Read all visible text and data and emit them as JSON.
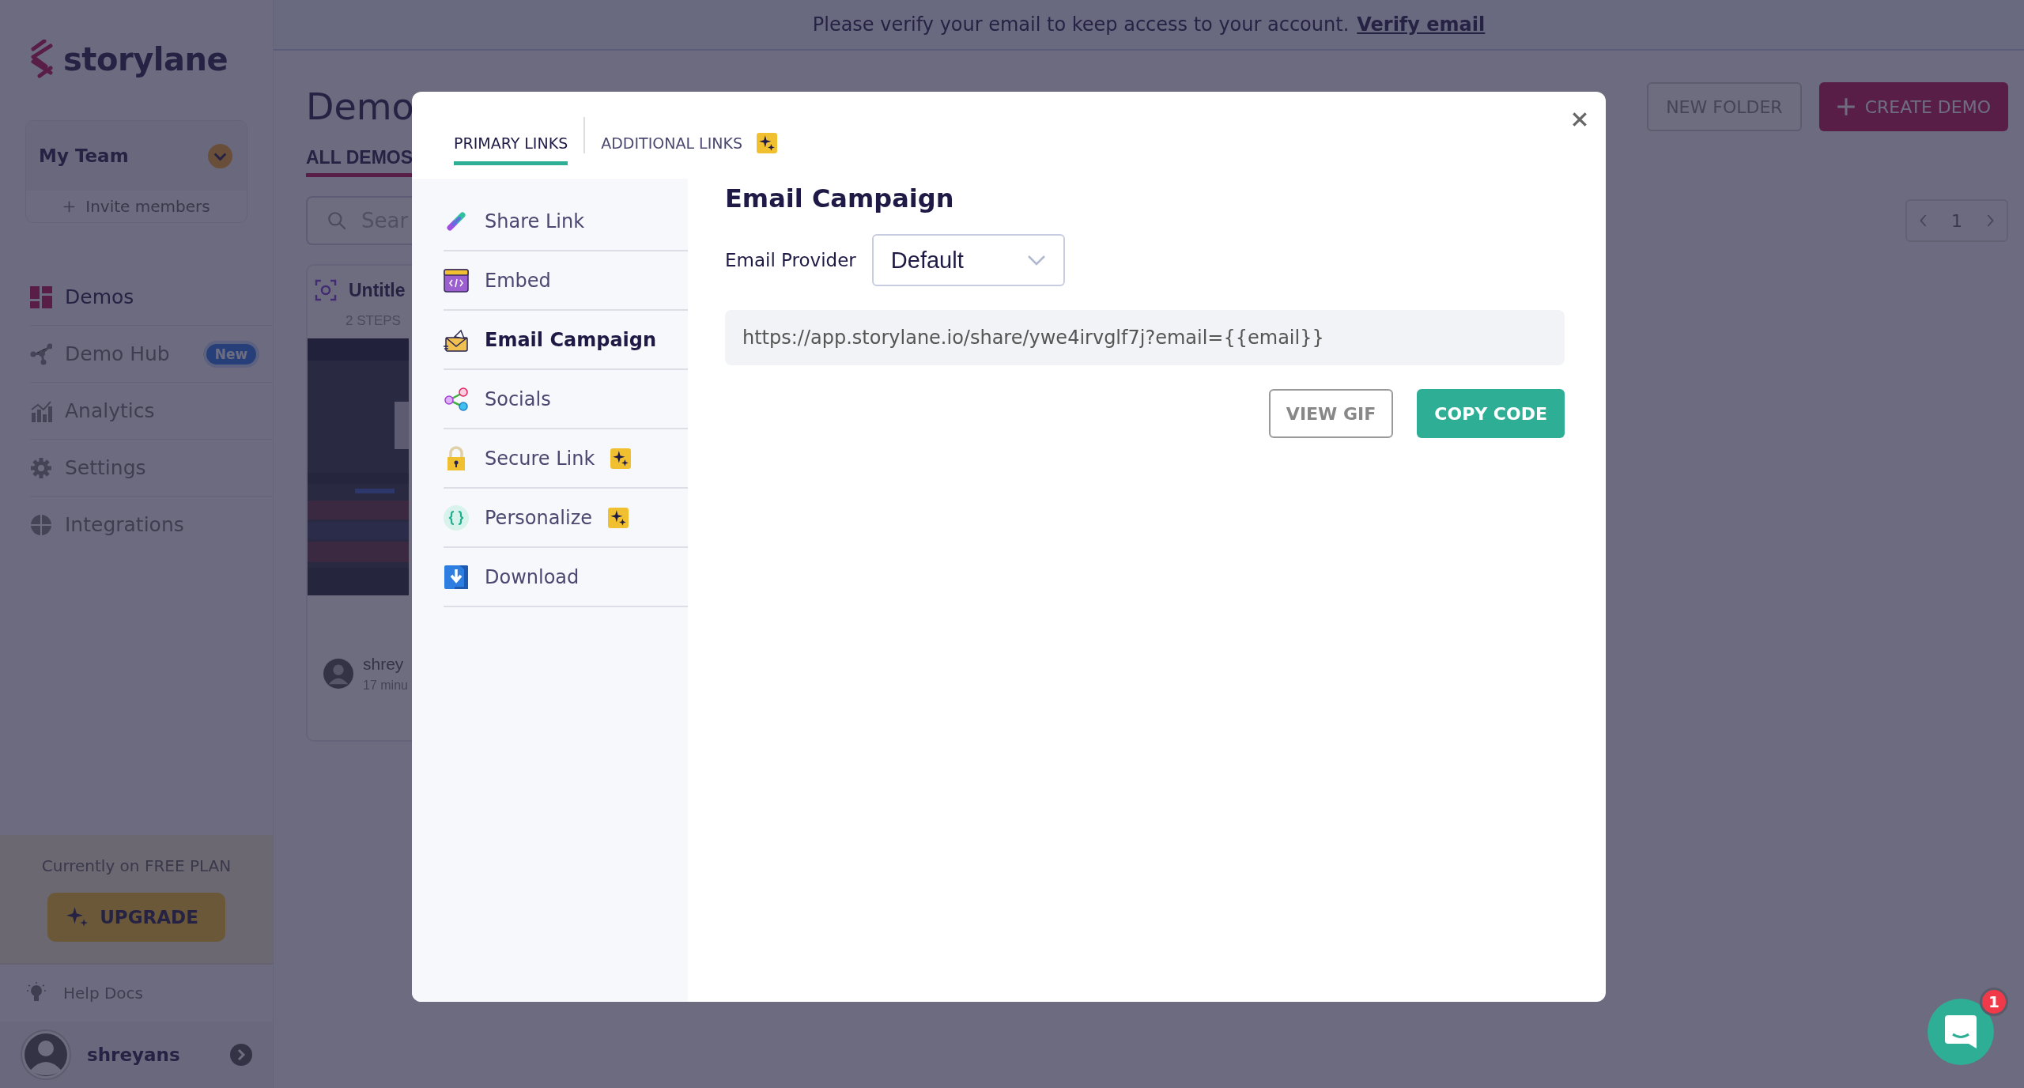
{
  "banner": {
    "text": "Please verify your email to keep access to your account.",
    "link": "Verify email"
  },
  "sidebar": {
    "logo": "storylane",
    "team": {
      "name": "My Team",
      "invite": "Invite members"
    },
    "nav": [
      {
        "label": "Demos",
        "kind": "demos",
        "selected": true
      },
      {
        "label": "Demo Hub",
        "kind": "hub",
        "badge": "New",
        "selected": false
      },
      {
        "label": "Analytics",
        "kind": "analytics",
        "selected": false
      },
      {
        "label": "Settings",
        "kind": "settings",
        "selected": false
      },
      {
        "label": "Integrations",
        "kind": "integrations",
        "selected": false
      }
    ],
    "plan": {
      "text": "Currently on FREE PLAN",
      "button": "UPGRADE"
    },
    "help": "Help Docs",
    "user": {
      "name": "shreyans"
    }
  },
  "main": {
    "title": "Demo",
    "tab": "ALL DEMOS",
    "search": {
      "placeholder": "Sear"
    },
    "buttons": [
      {
        "label": "NEW FOLDER",
        "kind": "outline"
      },
      {
        "label": "CREATE DEMO",
        "kind": "primary"
      }
    ],
    "pagination": {
      "page": "1"
    },
    "card": {
      "title": "Untitle",
      "steps": "2 STEPS",
      "author": "shrey",
      "time": "17 minu",
      "kind": "picture"
    }
  },
  "modal": {
    "tabs": [
      {
        "label": "PRIMARY LINKS",
        "selected": true,
        "premium": false
      },
      {
        "label": "ADDITIONAL LINKS",
        "selected": false,
        "premium": true
      }
    ],
    "nav": [
      {
        "label": "Share Link",
        "kind": "link",
        "selected": false,
        "premium": false
      },
      {
        "label": "Embed",
        "kind": "embed",
        "selected": false,
        "premium": false
      },
      {
        "label": "Email Campaign",
        "kind": "email",
        "selected": true,
        "premium": false
      },
      {
        "label": "Socials",
        "kind": "socials",
        "selected": false,
        "premium": false
      },
      {
        "label": "Secure Link",
        "kind": "lock",
        "selected": false,
        "premium": true
      },
      {
        "label": "Personalize",
        "kind": "braces",
        "selected": false,
        "premium": true
      },
      {
        "label": "Download",
        "kind": "download",
        "selected": false,
        "premium": false
      }
    ],
    "panel": {
      "title": "Email Campaign",
      "provider_label": "Email Provider",
      "provider": "Default",
      "url": "https://app.storylane.io/share/ywe4irvglf7j?email={{email}}",
      "buttons": [
        {
          "label": "VIEW GIF",
          "kind": "outline"
        },
        {
          "label": "COPY CODE",
          "kind": "primary"
        }
      ]
    }
  },
  "chat": {
    "badge": "1"
  }
}
